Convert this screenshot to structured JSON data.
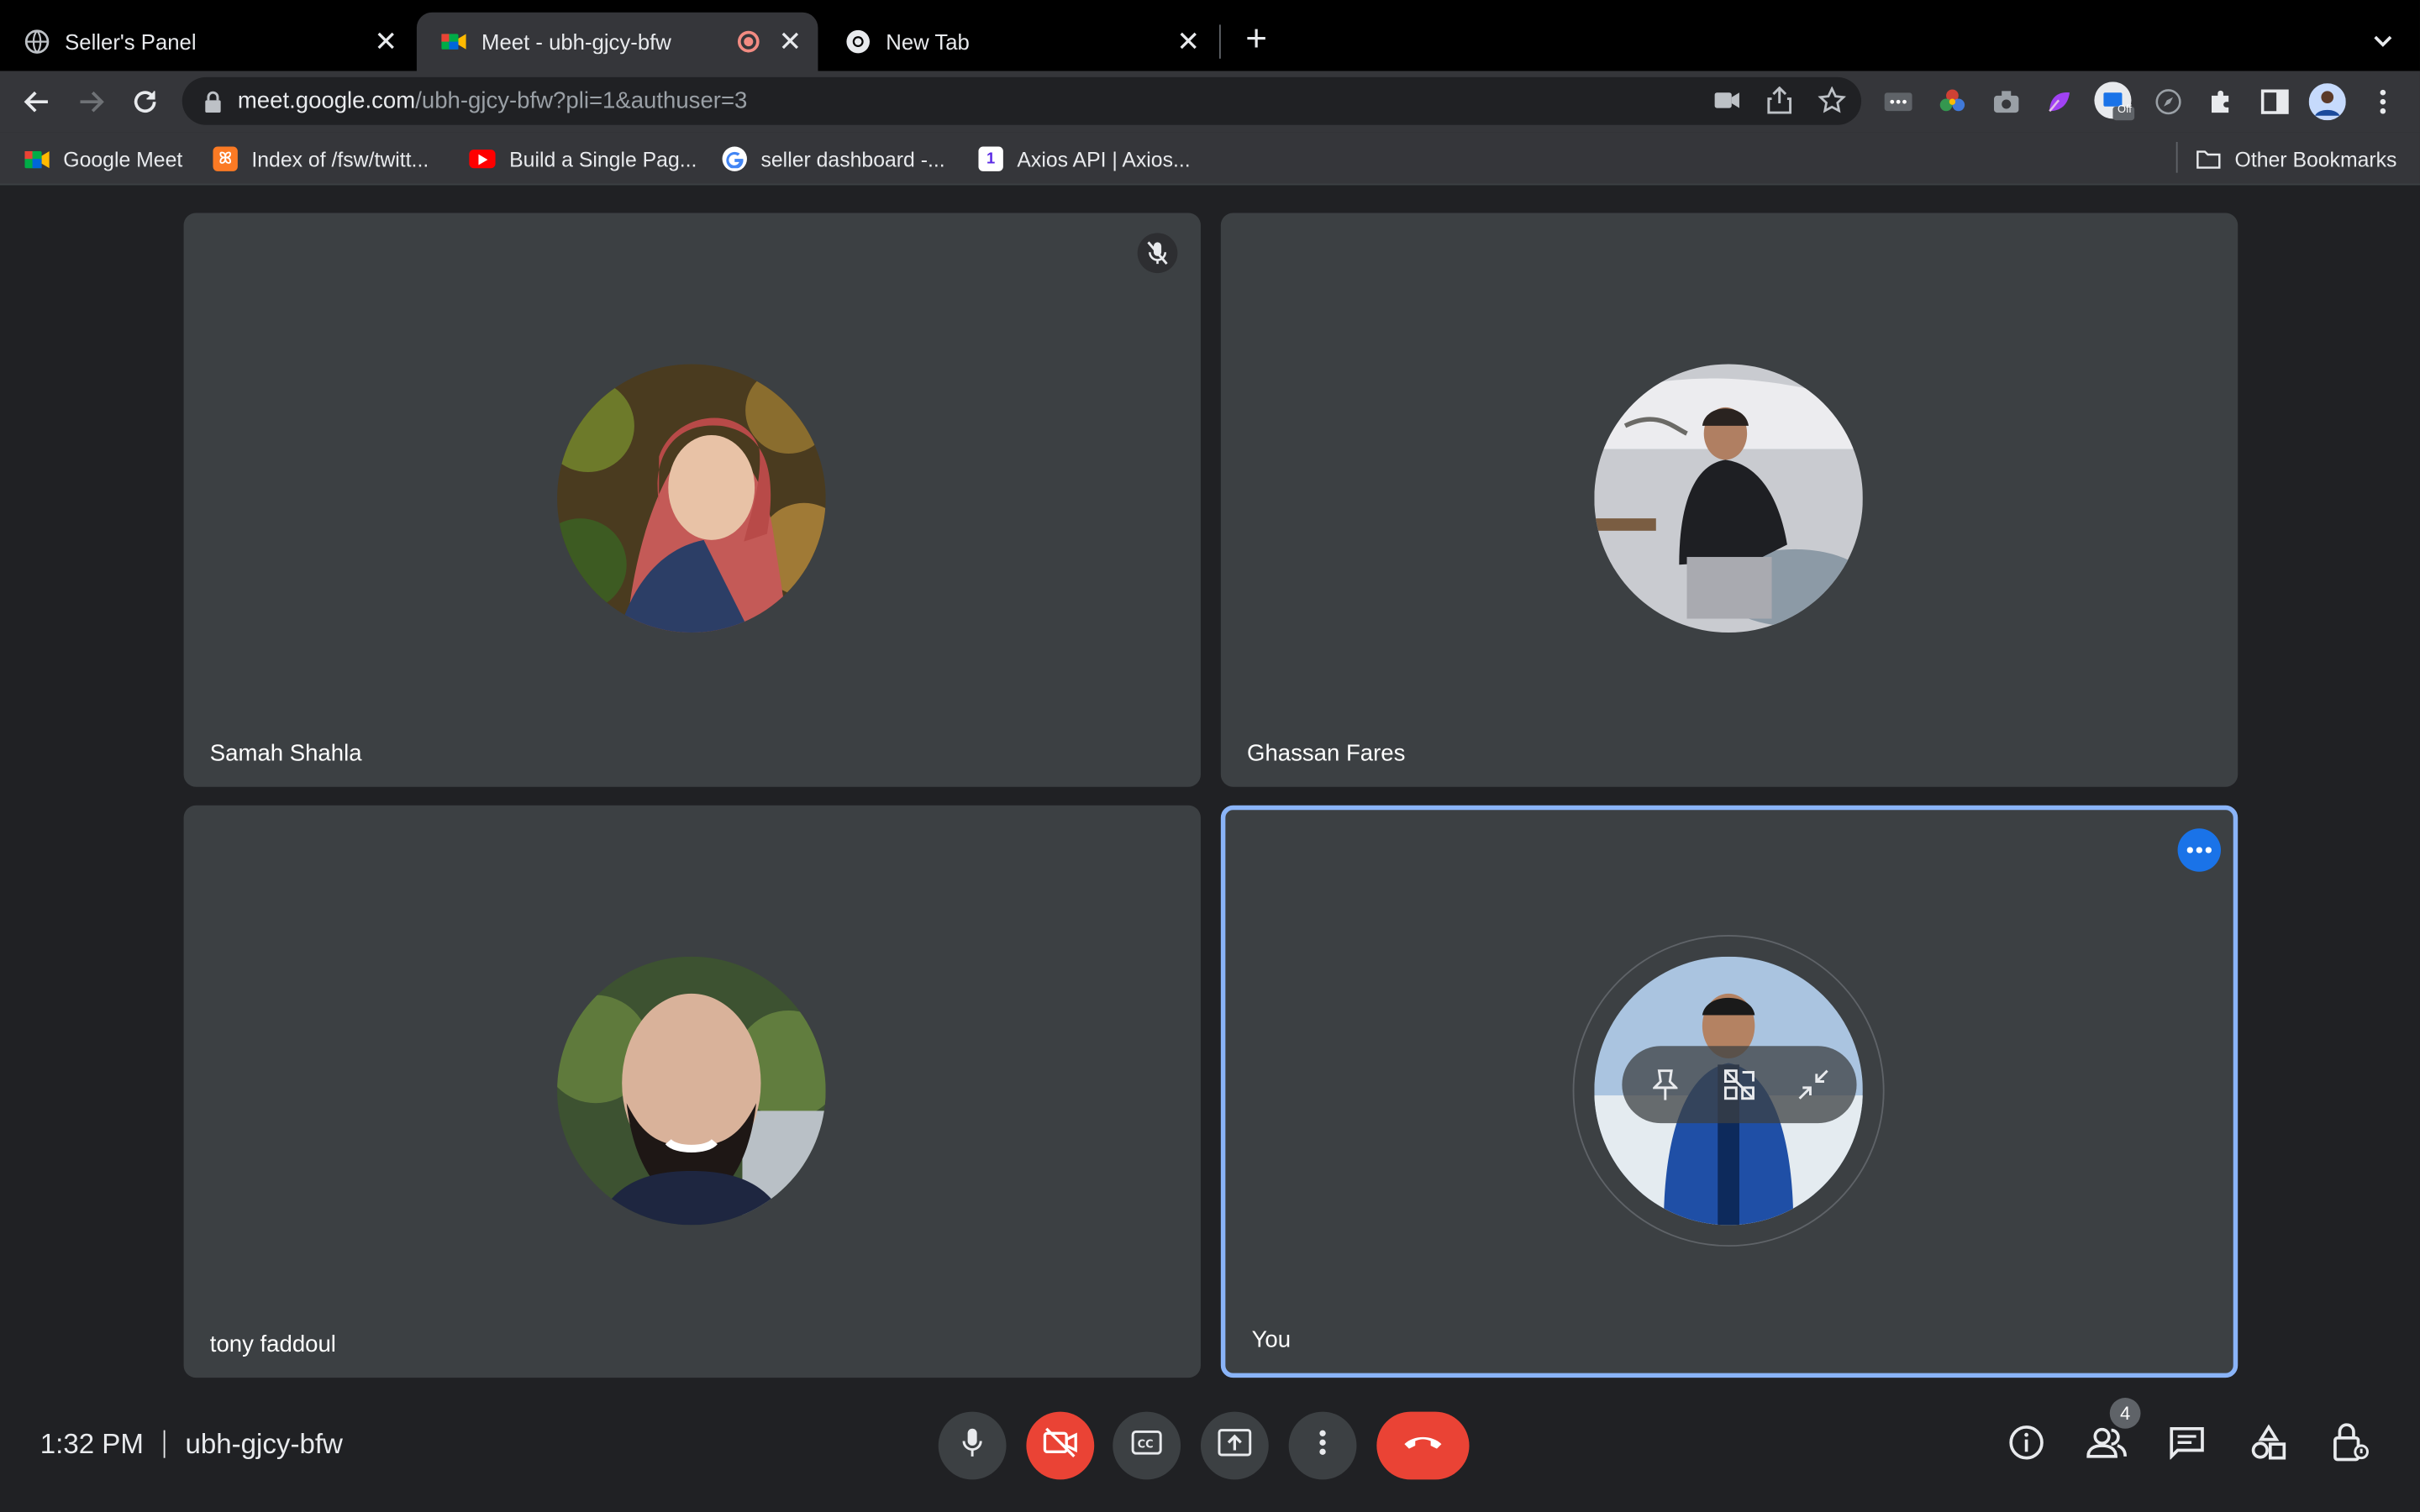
{
  "browser": {
    "tabs": [
      {
        "title": "Seller's Panel",
        "icon": "globe-icon"
      },
      {
        "title": "Meet - ubh-gjcy-bfw",
        "icon": "google-meet-icon",
        "recording": true
      },
      {
        "title": "New Tab",
        "icon": "chrome-icon"
      }
    ],
    "url_host": "meet.google.com",
    "url_path": "/ubh-gjcy-bfw?pli=1&authuser=3",
    "extension_badge": "Off"
  },
  "bookmarks": [
    {
      "label": "Google Meet",
      "icon": "google-meet-icon"
    },
    {
      "label": "Index of /fsw/twitt...",
      "icon": "xampp-icon"
    },
    {
      "label": "Build a Single Pag...",
      "icon": "youtube-icon"
    },
    {
      "label": "seller dashboard -...",
      "icon": "google-icon"
    },
    {
      "label": "Axios API | Axios...",
      "icon": "axios-icon"
    }
  ],
  "other_bookmarks": "Other Bookmarks",
  "meet": {
    "participants": [
      {
        "name": "Samah Shahla",
        "muted": true
      },
      {
        "name": "Ghassan Fares",
        "muted": false
      },
      {
        "name": "tony faddoul",
        "muted": false
      },
      {
        "name": "You",
        "muted": false,
        "self": true
      }
    ],
    "time": "1:32 PM",
    "meeting_code": "ubh-gjcy-bfw",
    "people_count": "4"
  },
  "colors": {
    "accent": "#8ab4f8",
    "danger": "#ea4335",
    "tile_bg": "#3c4043",
    "stage_bg": "#202124"
  }
}
